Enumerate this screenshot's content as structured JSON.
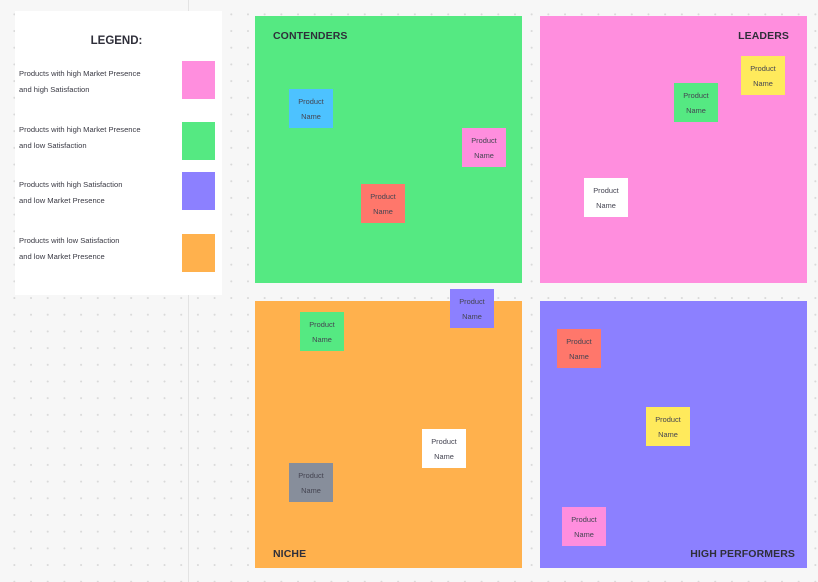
{
  "legend": {
    "title": "LEGEND:",
    "items": [
      {
        "line1": "Products with high Market Presence",
        "line2": "and high Satisfaction",
        "color": "#ff8ede"
      },
      {
        "line1": "Products with high Market Presence",
        "line2": "and low Satisfaction",
        "color": "#55e982"
      },
      {
        "line1": "Products with high Satisfaction",
        "line2": "and low Market Presence",
        "color": "#8c80ff"
      },
      {
        "line1": "Products with low Satisfaction",
        "line2": "and low Market Presence",
        "color": "#ffb14d"
      }
    ]
  },
  "quadrants": {
    "contenders": {
      "title": "CONTENDERS",
      "color": "#55e982"
    },
    "leaders": {
      "title": "LEADERS",
      "color": "#ff8ede"
    },
    "niche": {
      "title": "NICHE",
      "color": "#ffb14d"
    },
    "high_performers": {
      "title": "HIGH PERFORMERS",
      "color": "#8c80ff"
    }
  },
  "stickies": [
    {
      "line1": "Product",
      "line2": "Name",
      "color": "#4dc2ff",
      "quadrant": "contenders"
    },
    {
      "line1": "Product",
      "line2": "Name",
      "color": "#ff8ede",
      "quadrant": "contenders"
    },
    {
      "line1": "Product",
      "line2": "Name",
      "color": "#ff776b",
      "quadrant": "contenders"
    },
    {
      "line1": "Product",
      "line2": "Name",
      "color": "#ffea5c",
      "quadrant": "leaders"
    },
    {
      "line1": "Product",
      "line2": "Name",
      "color": "#55e982",
      "quadrant": "leaders"
    },
    {
      "line1": "Product",
      "line2": "Name",
      "color": "#ffffff",
      "quadrant": "leaders"
    },
    {
      "line1": "Product",
      "line2": "Name",
      "color": "#8c80ff",
      "quadrant": "niche"
    },
    {
      "line1": "Product",
      "line2": "Name",
      "color": "#55e982",
      "quadrant": "niche"
    },
    {
      "line1": "Product",
      "line2": "Name",
      "color": "#ffffff",
      "quadrant": "niche"
    },
    {
      "line1": "Product",
      "line2": "Name",
      "color": "#878e9b",
      "quadrant": "niche"
    },
    {
      "line1": "Product",
      "line2": "Name",
      "color": "#ff776b",
      "quadrant": "high_performers"
    },
    {
      "line1": "Product",
      "line2": "Name",
      "color": "#ffea5c",
      "quadrant": "high_performers"
    },
    {
      "line1": "Product",
      "line2": "Name",
      "color": "#ff8ede",
      "quadrant": "high_performers"
    }
  ]
}
